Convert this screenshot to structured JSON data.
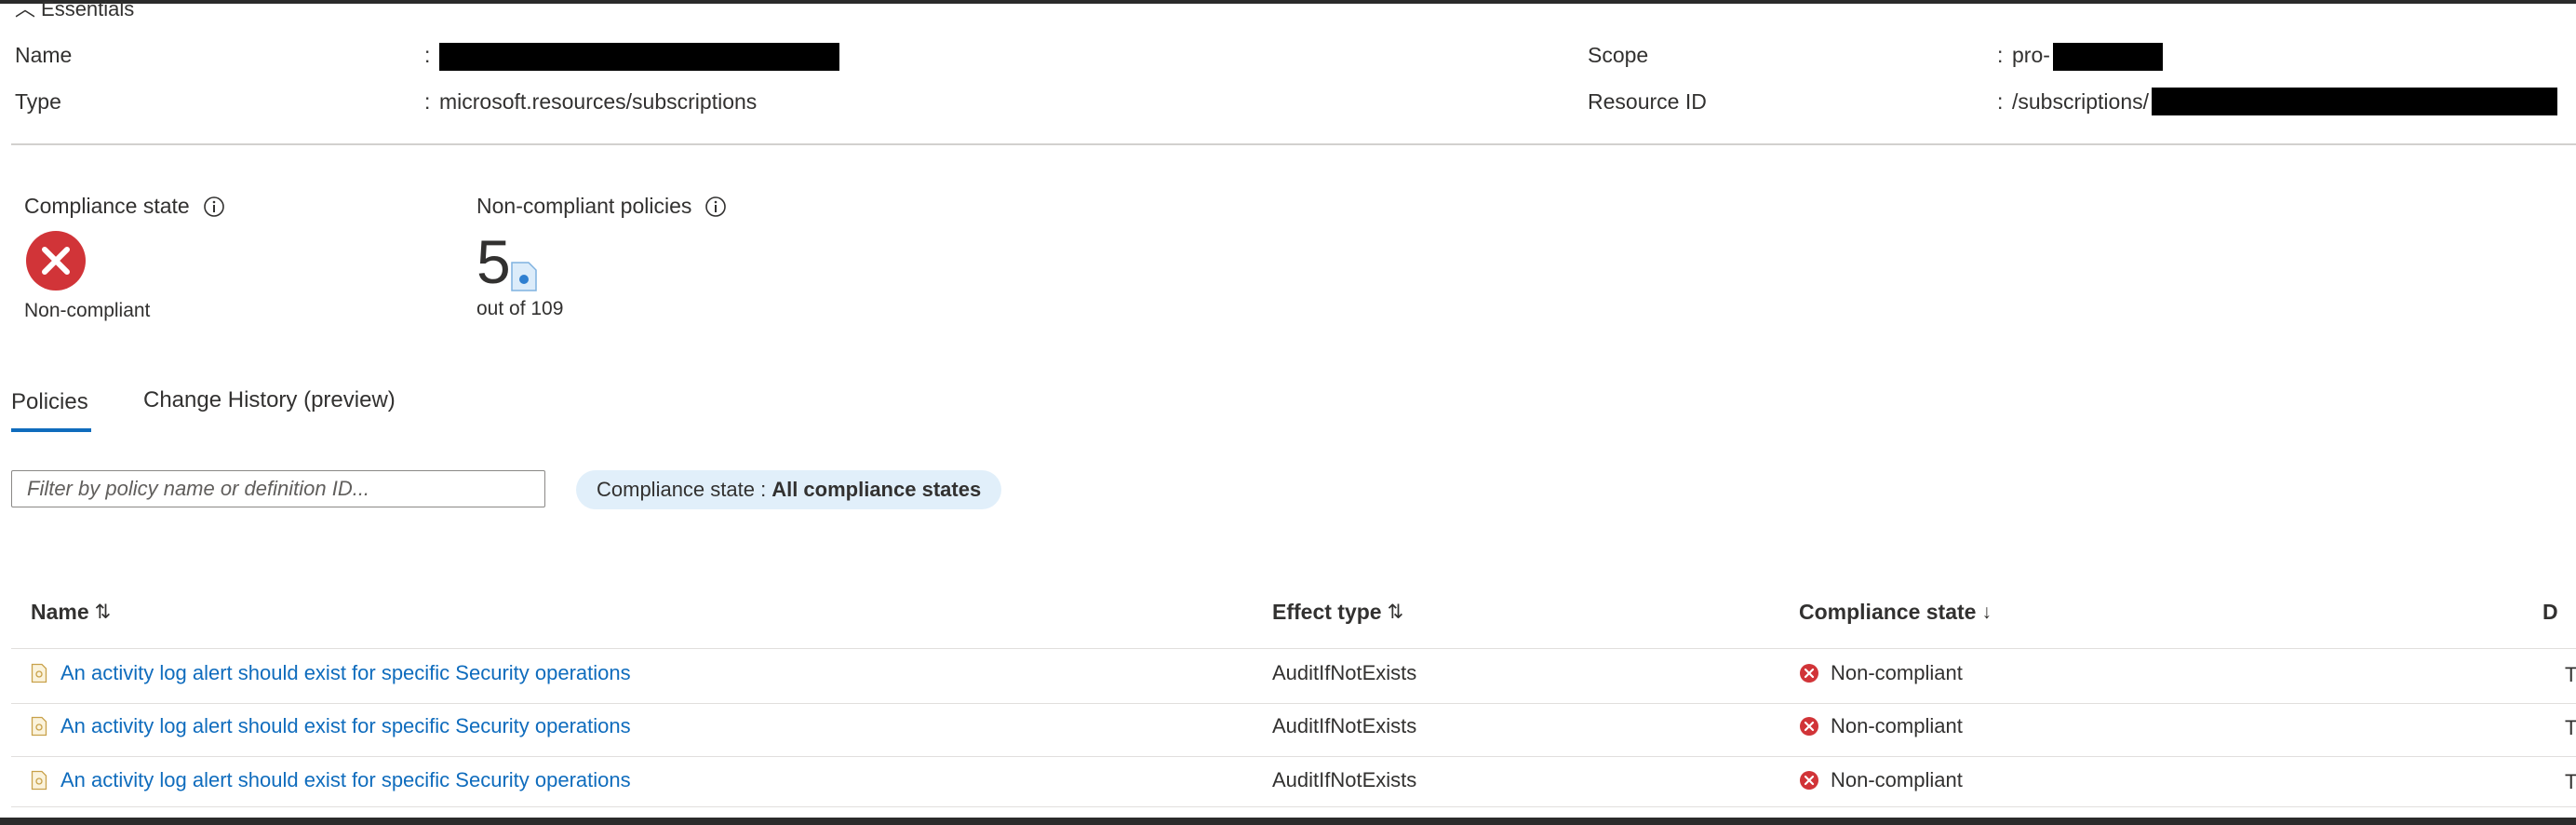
{
  "essentials": {
    "toggle_label": "Essentials",
    "name_label": "Name",
    "name_value": "",
    "type_label": "Type",
    "type_value": "microsoft.resources/subscriptions",
    "scope_label": "Scope",
    "scope_value_prefix": "pro-",
    "resource_id_label": "Resource ID",
    "resource_id_prefix": "/subscriptions/",
    "colon": ":"
  },
  "metrics": {
    "compliance_state_title": "Compliance state",
    "compliance_state_value": "Non-compliant",
    "noncompliant_policies_title": "Non-compliant policies",
    "noncompliant_count": "5",
    "noncompliant_total": "out of 109"
  },
  "tabs": [
    {
      "label": "Policies",
      "selected": true
    },
    {
      "label": "Change History (preview)",
      "selected": false
    }
  ],
  "filter": {
    "placeholder": "Filter by policy name or definition ID...",
    "value": ""
  },
  "compliance_filter": {
    "label": "Compliance state :",
    "value": "All compliance states"
  },
  "table": {
    "columns": [
      {
        "label": "Name",
        "sort": "⇅"
      },
      {
        "label": "Effect type",
        "sort": "⇅"
      },
      {
        "label": "Compliance state",
        "sort": "↓"
      },
      {
        "label": "D",
        "sort": ""
      }
    ],
    "rows": [
      {
        "name": "An activity log alert should exist for specific Security operations",
        "effect": "AuditIfNotExists",
        "state": "Non-compliant",
        "next": "T"
      },
      {
        "name": "An activity log alert should exist for specific Security operations",
        "effect": "AuditIfNotExists",
        "state": "Non-compliant",
        "next": "T"
      },
      {
        "name": "An activity log alert should exist for specific Security operations",
        "effect": "AuditIfNotExists",
        "state": "Non-compliant",
        "next": "T"
      }
    ]
  },
  "colors": {
    "accent": "#0f6cbd",
    "error": "#d13438",
    "pill_bg": "#e1effa"
  }
}
